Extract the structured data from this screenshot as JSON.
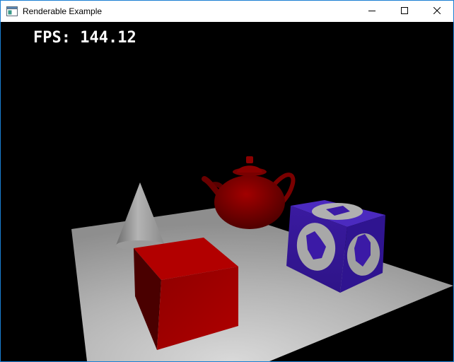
{
  "window": {
    "title": "Renderable Example",
    "app_icon": "window-app-icon",
    "controls": {
      "minimize_icon": "minimize-icon",
      "maximize_icon": "maximize-icon",
      "close_icon": "close-icon"
    }
  },
  "viewport": {
    "background": "#000000",
    "fps_label": "FPS: 144.12",
    "scene_objects": [
      "floor-plane",
      "cone",
      "teapot",
      "red-box",
      "textured-cube"
    ],
    "colors": {
      "floor": "#b8b8b8",
      "cone": "#9a9a9a",
      "teapot": "#8c0000",
      "red_box": "#a80000",
      "textured_cube": "#3b1aa6",
      "cube_emblem": "#a8a8a8"
    }
  }
}
